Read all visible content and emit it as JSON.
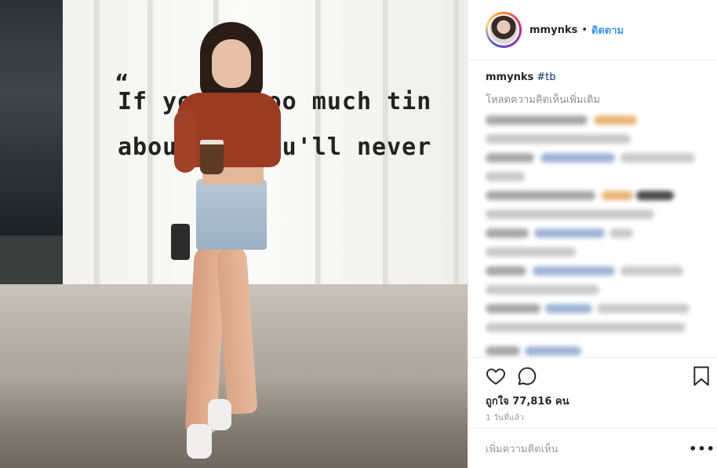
{
  "photo": {
    "wall_quote_mark": "“",
    "wall_text_line1": "If you       d too much tin",
    "wall_text_line2": "abou      ng, you'll never"
  },
  "header": {
    "username": "mmynks",
    "separator": "•",
    "follow_label": "ติดตาม"
  },
  "caption": {
    "username": "mmynks",
    "hashtag": "#tb"
  },
  "comments": {
    "load_more": "โหลดความคิดเห็นเพิ่มเติม"
  },
  "actions": {
    "like_icon": "heart-icon",
    "comment_icon": "comment-bubble-icon",
    "save_icon": "bookmark-icon"
  },
  "likes": {
    "label": "ถูกใจ 77,816 คน"
  },
  "timestamp": "1 วันที่แล้ว",
  "add_comment": {
    "placeholder": "เพิ่มความคิดเห็น",
    "more_label": "•••"
  }
}
